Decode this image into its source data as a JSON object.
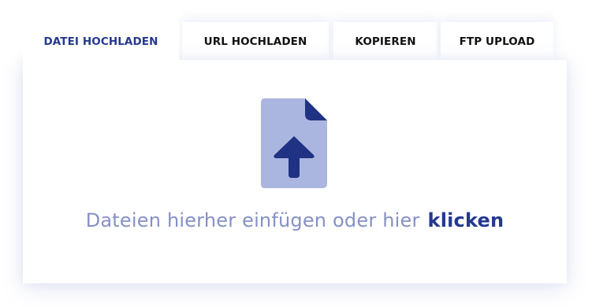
{
  "tabs": [
    {
      "label": "DATEI HOCHLADEN",
      "active": true
    },
    {
      "label": "URL HOCHLADEN",
      "active": false
    },
    {
      "label": "KOPIEREN",
      "active": false
    },
    {
      "label": "FTP UPLOAD",
      "active": false
    }
  ],
  "dropzone": {
    "icon": "file-upload-icon",
    "text": "Dateien hierher einfügen oder hier",
    "link_label": "klicken"
  },
  "colors": {
    "accent": "#24398f",
    "icon_light": "#aab6e0",
    "text_muted": "#8590c6"
  }
}
